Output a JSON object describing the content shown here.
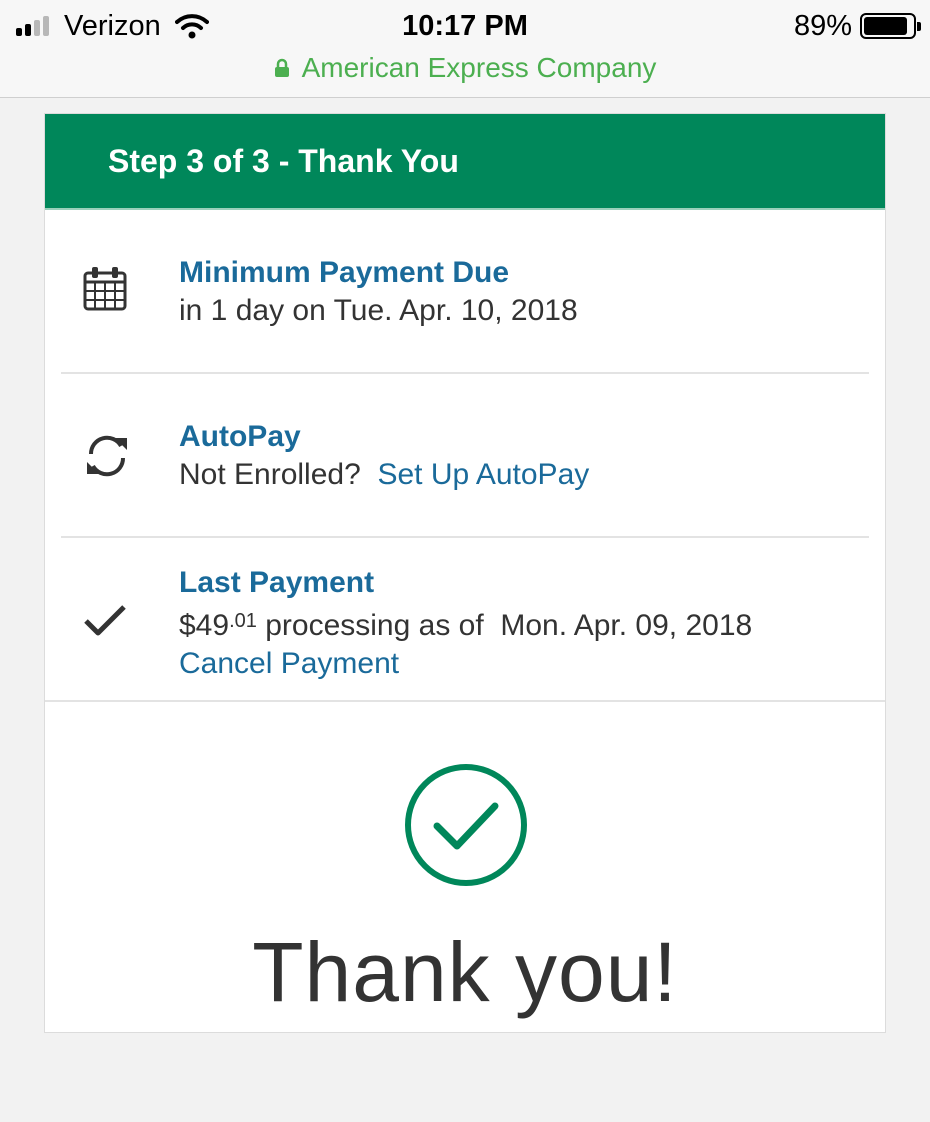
{
  "status_bar": {
    "carrier": "Verizon",
    "time": "10:17 PM",
    "battery_percent": "89%",
    "battery_level": 0.89
  },
  "url_bar": {
    "site_name": "American Express Company"
  },
  "card": {
    "header": "Step 3 of 3 - Thank You",
    "minimum_payment": {
      "title": "Minimum Payment Due",
      "detail": "in 1 day on Tue. Apr. 10, 2018"
    },
    "autopay": {
      "title": "AutoPay",
      "status": "Not Enrolled?",
      "link": "Set Up AutoPay"
    },
    "last_payment": {
      "title": "Last Payment",
      "amount_dollars": "$49",
      "amount_cents": ".01",
      "status": "processing as of",
      "date": "Mon. Apr. 09, 2018",
      "cancel_link": "Cancel Payment"
    },
    "confirmation": {
      "message": "Thank you!"
    }
  },
  "colors": {
    "brand_green": "#00875a",
    "link_blue": "#1a6a9a",
    "secure_green": "#4caf50"
  }
}
